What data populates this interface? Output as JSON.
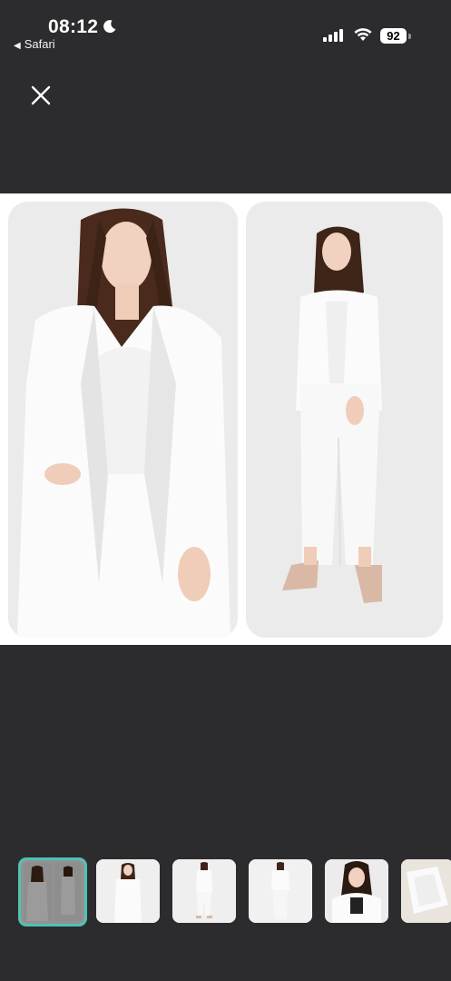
{
  "status_bar": {
    "time": "08:12",
    "back_app": "Safari",
    "battery_level": "92",
    "signal_strength": 4
  },
  "close_button": {
    "icon": "close-icon"
  },
  "viewer": {
    "images": [
      {
        "subject": "woman-in-white-blazer-closeup"
      },
      {
        "subject": "woman-in-white-suit-full-length"
      }
    ]
  },
  "thumbnails": {
    "count": 6,
    "selected_index": 0,
    "accent_color": "#4ec3b2"
  },
  "colors": {
    "background": "#2c2c2e",
    "viewer_background": "#ffffff"
  }
}
